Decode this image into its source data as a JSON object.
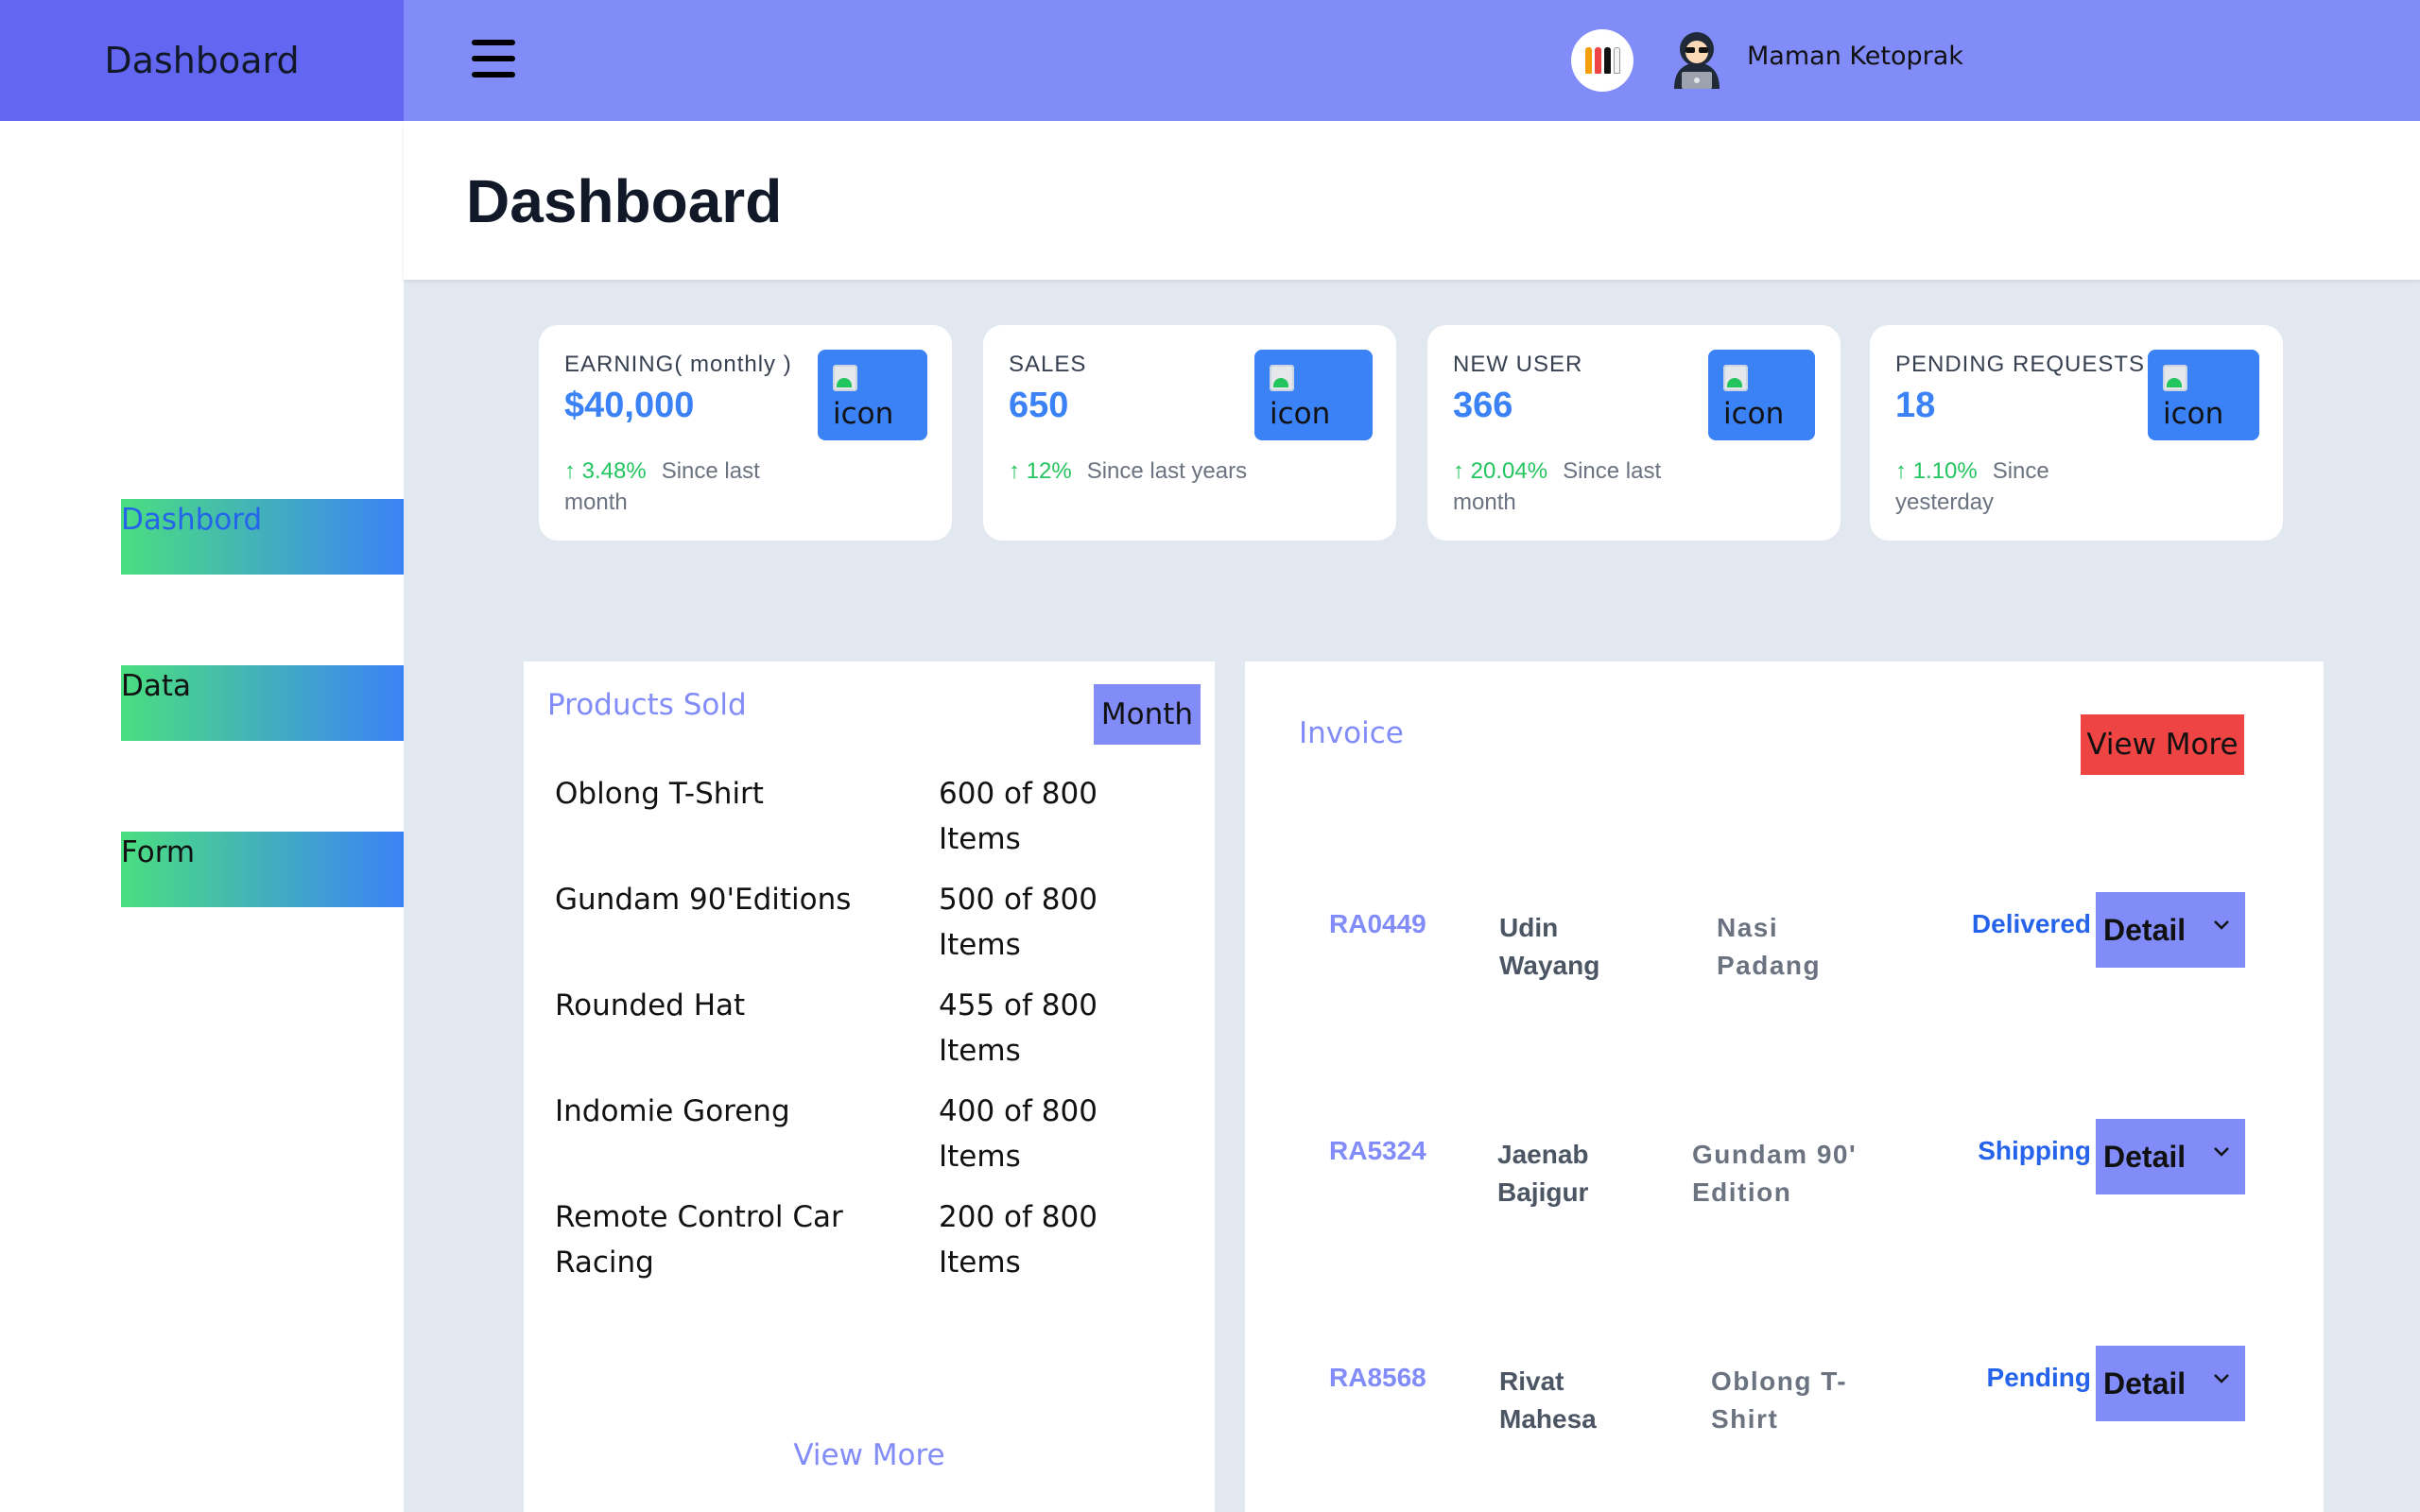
{
  "header": {
    "brand": "Dashboard",
    "username": "Maman Ketoprak",
    "menu_icon": "hamburger-icon",
    "badge_icon": "brushes-logo",
    "avatar_icon": "hacker-avatar"
  },
  "sidebar": {
    "items": [
      {
        "label": "Dashbord",
        "color": "#2563eb"
      },
      {
        "label": "Data",
        "color": "#111111"
      },
      {
        "label": "Form",
        "color": "#111111"
      }
    ]
  },
  "page": {
    "title": "Dashboard"
  },
  "stats": [
    {
      "label": "EARNING( monthly )",
      "value": "$40,000",
      "change": "↑ 3.48%",
      "note": "Since last month",
      "icon_alt": "icon"
    },
    {
      "label": "SALES",
      "value": "650",
      "change": "↑ 12%",
      "note": "Since last years",
      "icon_alt": "icon"
    },
    {
      "label": "NEW USER",
      "value": "366",
      "change": "↑ 20.04%",
      "note": "Since last month",
      "icon_alt": "icon"
    },
    {
      "label": "PENDING REQUESTS",
      "value": "18",
      "change": "↑ 1.10%",
      "note": "Since yesterday",
      "icon_alt": "icon"
    }
  ],
  "products": {
    "title": "Products Sold",
    "filter_label": "Month",
    "items": [
      {
        "name": "Oblong T-Shirt",
        "qty": "600 of 800 Items"
      },
      {
        "name": "Gundam 90'Editions",
        "qty": "500 of 800 Items"
      },
      {
        "name": "Rounded Hat",
        "qty": "455 of 800 Items"
      },
      {
        "name": "Indomie Goreng",
        "qty": "400 of 800 Items"
      },
      {
        "name": "Remote Control Car Racing",
        "qty": "200 of 800 Items"
      }
    ],
    "view_more": "View More"
  },
  "invoice": {
    "title": "Invoice",
    "view_more": "View More",
    "rows": [
      {
        "id": "RA0449",
        "customer": "Udin Wayang",
        "product": "Nasi Padang",
        "status": "Delivered",
        "action": "Detail"
      },
      {
        "id": "RA5324",
        "customer": "Jaenab Bajigur",
        "product": "Gundam 90' Edition",
        "status": "Shipping",
        "action": "Detail"
      },
      {
        "id": "RA8568",
        "customer": "Rivat Mahesa",
        "product": "Oblong T-Shirt",
        "status": "Pending",
        "action": "Detail"
      }
    ]
  },
  "colors": {
    "brand": "#6366f1",
    "topbar": "#818cf8",
    "accent": "#3b82f6",
    "positive": "#22c55e",
    "danger": "#ef4444"
  }
}
